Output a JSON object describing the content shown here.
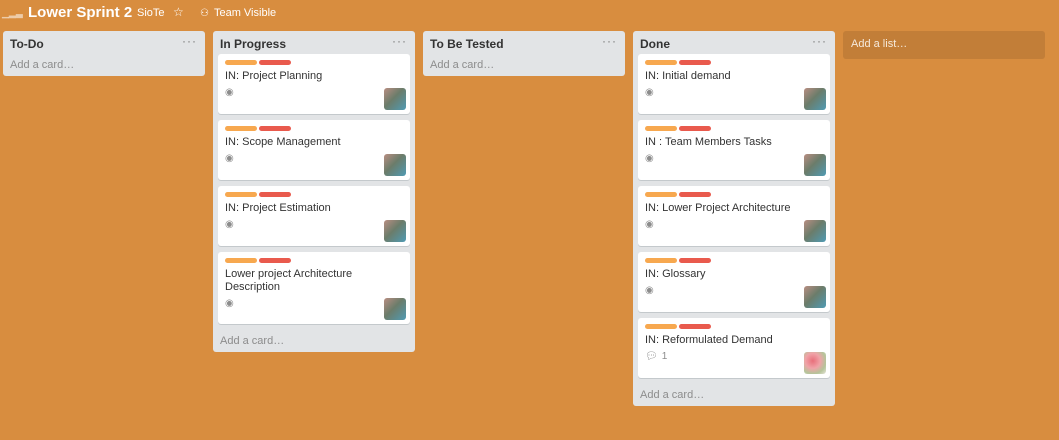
{
  "header": {
    "board_title": "Lower Sprint 2",
    "org": "SioTe",
    "star_icon": "star-icon",
    "visibility": "Team Visible"
  },
  "lists": [
    {
      "title": "To-Do",
      "add_card": "Add a card…",
      "cards": []
    },
    {
      "title": "In Progress",
      "add_card": "Add a card…",
      "cards": [
        {
          "title": "IN: Project Planning"
        },
        {
          "title": "IN: Scope Management"
        },
        {
          "title": "IN: Project Estimation"
        },
        {
          "title": "Lower project Architecture Description"
        }
      ]
    },
    {
      "title": "To Be Tested",
      "add_card": "Add a card…",
      "cards": []
    },
    {
      "title": "Done",
      "add_card": "Add a card…",
      "cards": [
        {
          "title": "IN: Initial demand"
        },
        {
          "title": "IN : Team Members Tasks"
        },
        {
          "title": "IN: Lower Project Architecture"
        },
        {
          "title": "IN: Glossary"
        },
        {
          "title": "IN: Reformulated Demand",
          "comments": "1"
        }
      ]
    }
  ],
  "add_list": "Add a list…",
  "menu_glyph": "···",
  "colors": {
    "background": "#d88d3f",
    "label_orange": "#f7a84f",
    "label_red": "#e95a4d",
    "list_bg": "#e2e4e6"
  }
}
